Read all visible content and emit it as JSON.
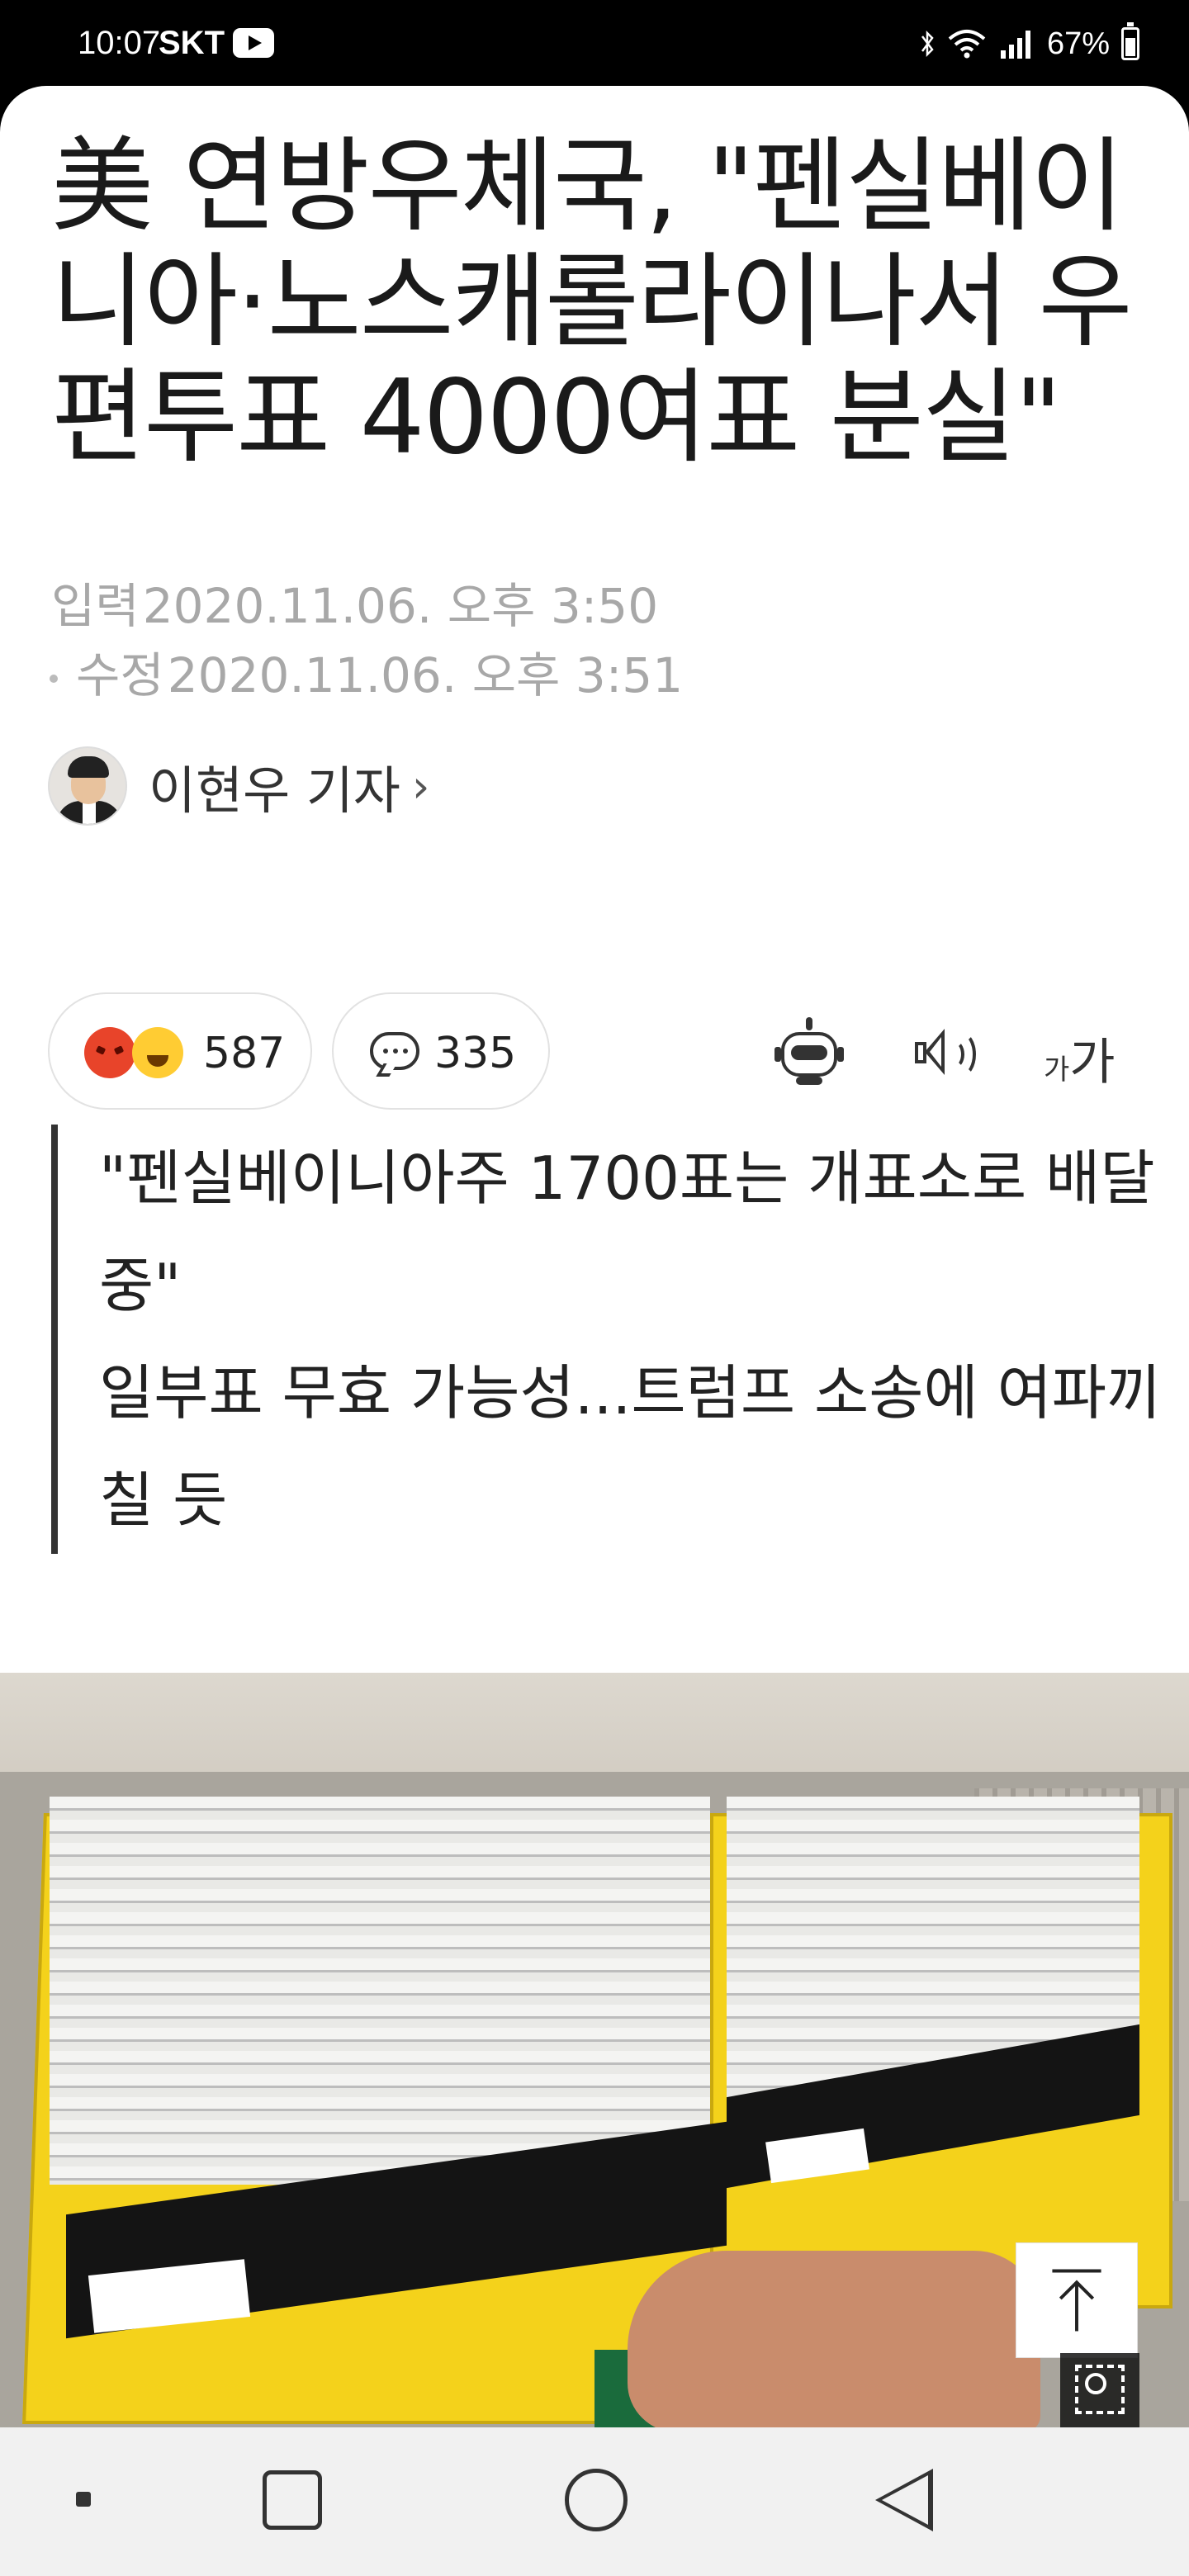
{
  "status_bar": {
    "time": "10:07",
    "carrier": "SKT",
    "battery_pct": "67%"
  },
  "article": {
    "headline": "美 연방우체국, \"펜실베이니아·노스캐롤라이나서 우편투표 4000여표 분실\"",
    "input_label": "입력",
    "input_date": "2020.11.06. 오후 3:50",
    "modified_label": "수정",
    "modified_date": "2020.11.06. 오후 3:51",
    "reporter": "이현우 기자"
  },
  "actions": {
    "reaction_count": "587",
    "comment_count": "335",
    "font_small": "가",
    "font_big": "가"
  },
  "subhead": {
    "line1": "\"펜실베이니아주 1700표는 개표소로 배달 중\"",
    "line2": "일부표 무효 가능성...트럼프 소송에 여파끼칠 듯"
  },
  "icons": {
    "reactions": [
      "angry-emoji-icon",
      "laugh-emoji-icon"
    ],
    "comment": "comment-icon",
    "summary_bot": "robot-icon",
    "tts": "speaker-icon",
    "font_size": "font-size-icon",
    "scroll_top": "arrow-up-icon",
    "lens": "lens-search-icon"
  },
  "colors": {
    "angry": "#e8442a",
    "laugh": "#ffcc33",
    "date_text": "#a8a8a8"
  }
}
